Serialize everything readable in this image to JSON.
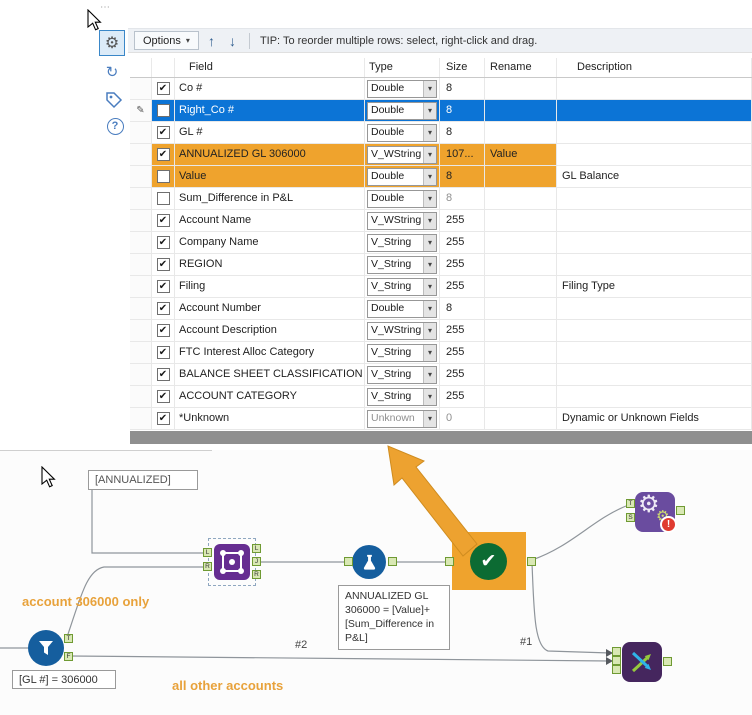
{
  "toolbar": {
    "options_label": "Options",
    "tip": "TIP: To reorder multiple rows: select, right-click and drag."
  },
  "icons": {
    "check": "✔",
    "dropdown": "▾",
    "pencil": "✎",
    "up": "↑",
    "down": "↓",
    "gear": "⚙",
    "refresh": "↻",
    "help": "?",
    "grip": "⋯",
    "error": "!"
  },
  "colors": {
    "selection_blue": "#0c74d6",
    "highlight_orange": "#efa32d",
    "tool_purple": "#662d91",
    "tool_blue": "#155e9e",
    "select_green": "#0c6b33",
    "error_red": "#e03b30"
  },
  "table": {
    "headers": [
      "Field",
      "Type",
      "Size",
      "Rename",
      "Description"
    ],
    "rows": [
      {
        "checked": true,
        "field": "Co #",
        "type": "Double",
        "size": "8",
        "rename": "",
        "description": "",
        "highlight": "none"
      },
      {
        "checked": false,
        "field": "Right_Co #",
        "type": "Double",
        "size": "8",
        "rename": "",
        "description": "",
        "highlight": "selected"
      },
      {
        "checked": true,
        "field": "GL #",
        "type": "Double",
        "size": "8",
        "rename": "",
        "description": "",
        "highlight": "none"
      },
      {
        "checked": true,
        "field": "ANNUALIZED GL 306000",
        "type": "V_WString",
        "size": "107...",
        "rename": "Value",
        "description": "",
        "highlight": "orange"
      },
      {
        "checked": false,
        "field": "Value",
        "type": "Double",
        "size": "8",
        "rename": "",
        "description": "GL Balance",
        "highlight": "orange"
      },
      {
        "checked": false,
        "field": "Sum_Difference in P&L",
        "type": "Double",
        "size": "8",
        "rename": "",
        "description": "",
        "highlight": "none"
      },
      {
        "checked": true,
        "field": "Account Name",
        "type": "V_WString",
        "size": "255",
        "rename": "",
        "description": "",
        "highlight": "none"
      },
      {
        "checked": true,
        "field": "Company Name",
        "type": "V_String",
        "size": "255",
        "rename": "",
        "description": "",
        "highlight": "none"
      },
      {
        "checked": true,
        "field": "REGION",
        "type": "V_String",
        "size": "255",
        "rename": "",
        "description": "",
        "highlight": "none"
      },
      {
        "checked": true,
        "field": "Filing",
        "type": "V_String",
        "size": "255",
        "rename": "",
        "description": "Filing Type",
        "highlight": "none"
      },
      {
        "checked": true,
        "field": "Account Number",
        "type": "Double",
        "size": "8",
        "rename": "",
        "description": "",
        "highlight": "none"
      },
      {
        "checked": true,
        "field": "Account Description",
        "type": "V_WString",
        "size": "255",
        "rename": "",
        "description": "",
        "highlight": "none"
      },
      {
        "checked": true,
        "field": "FTC Interest Alloc Category",
        "type": "V_String",
        "size": "255",
        "rename": "",
        "description": "",
        "highlight": "none"
      },
      {
        "checked": true,
        "field": "BALANCE SHEET CLASSIFICATION",
        "type": "V_String",
        "size": "255",
        "rename": "",
        "description": "",
        "highlight": "none"
      },
      {
        "checked": true,
        "field": "ACCOUNT CATEGORY",
        "type": "V_String",
        "size": "255",
        "rename": "",
        "description": "",
        "highlight": "none"
      },
      {
        "checked": true,
        "field": "*Unknown",
        "type": "Unknown",
        "size": "0",
        "rename": "",
        "description": "Dynamic or Unknown Fields",
        "highlight": "none"
      }
    ]
  },
  "canvas": {
    "notes": {
      "annualized": "[ANNUALIZED]",
      "formula_note": "ANNUALIZED GL 306000 = [Value]+ [Sum_Difference in P&L]",
      "filter_expr": "[GL #] = 306000",
      "account_only": "account 306000 only",
      "all_other": "all other accounts"
    },
    "labels": {
      "conn1": "#1",
      "conn2": "#2"
    },
    "tools": {
      "filter": {
        "t": "T",
        "f": "F"
      },
      "join": {
        "left": [
          "L",
          "R"
        ],
        "right": [
          "L",
          "J",
          "R"
        ]
      },
      "gears": {
        "t": "T",
        "s": "S",
        "error": "!"
      }
    }
  }
}
